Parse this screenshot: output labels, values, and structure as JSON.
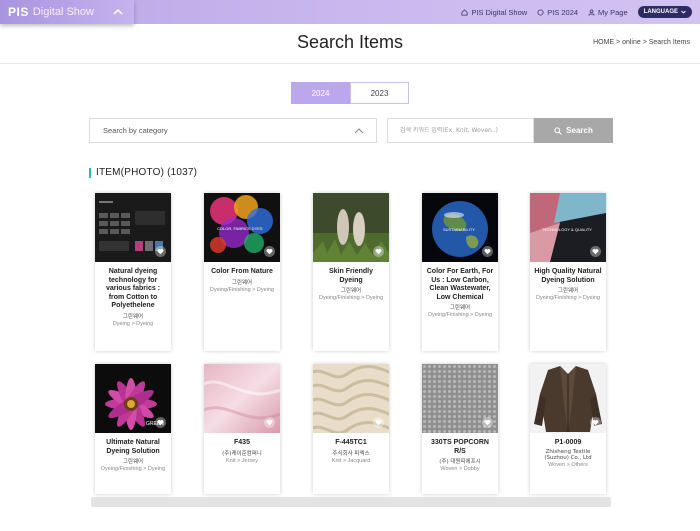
{
  "header": {
    "brand_main": "PIS",
    "brand_sub": "Digital Show",
    "nav": [
      {
        "label": "PIS Digital Show",
        "icon": "home-icon"
      },
      {
        "label": "PIS 2024",
        "icon": "globe-icon"
      },
      {
        "label": "My Page",
        "icon": "user-icon"
      }
    ],
    "language": "LANGUAGE"
  },
  "page": {
    "title": "Search Items",
    "breadcrumb": "HOME > online > Search Items"
  },
  "years": [
    {
      "label": "2024",
      "active": true
    },
    {
      "label": "2023",
      "active": false
    }
  ],
  "search": {
    "category_placeholder": "Search by category",
    "keyword_placeholder": "검색 키워드 입력(Ex. Knit, Woven..)",
    "button": "Search"
  },
  "section": {
    "title": "ITEM(PHOTO) (1037)"
  },
  "items": [
    {
      "name": "Natural dyeing technology for various fabrics : from Cotton to Polyethelene",
      "company": "그린웨어",
      "category": "Dyeing > Dyeing",
      "image": "dark-presentation"
    },
    {
      "name": "Color From Nature",
      "company": "그린웨어",
      "category": "Dyeing/Finishing > Dyeing",
      "image": "colorful-ink-swirl",
      "overlay": "COLOR, FABRICS DYES"
    },
    {
      "name": "Skin Friendly Dyeing",
      "company": "그린웨어",
      "category": "Dyeing/Finishing > Dyeing",
      "image": "bare-feet-grass"
    },
    {
      "name": "Color For Earth, For Us : Low Carbon, Clean Wastewater, Low Chemical",
      "company": "그린웨어",
      "category": "Dyeing/Finishing > Dyeing",
      "image": "earth-globe",
      "overlay": "SUSTAINABILITY"
    },
    {
      "name": "High Quality Natural Dyeing Solution",
      "company": "그린웨어",
      "category": "Dyeing/Finishing > Dyeing",
      "image": "fabric-swatches",
      "overlay": "TECHNOLOGY & QUALITY"
    },
    {
      "name": "Ultimate Natural Dyeing Solution",
      "company": "그린웨어",
      "category": "Dyeing/Finishing > Dyeing",
      "image": "purple-flower",
      "overlay": "GREEN"
    },
    {
      "name": "F435",
      "company": "(주)케이준컴퍼니",
      "category": "Knit > Jersey",
      "image": "pink-satin"
    },
    {
      "name": "F-445TC1",
      "company": "주식회사 피엑스",
      "category": "Knit > Jacquard",
      "image": "cream-knit"
    },
    {
      "name": "330TS POPCORN R/S",
      "company": "(주) 대원피에프시",
      "category": "Woven > Dobby",
      "image": "grey-textured-fabric"
    },
    {
      "name": "P1-0009",
      "company": "Zhisheng Textile (Suzhou) Co., Ltd",
      "category": "Woven > Others",
      "image": "leather-jacket"
    }
  ],
  "colors": {
    "accent": "#bba7ee",
    "header_bg": "#c9b8ee",
    "section_marker": "#31b7b0",
    "search_button": "#a8a8a8"
  }
}
